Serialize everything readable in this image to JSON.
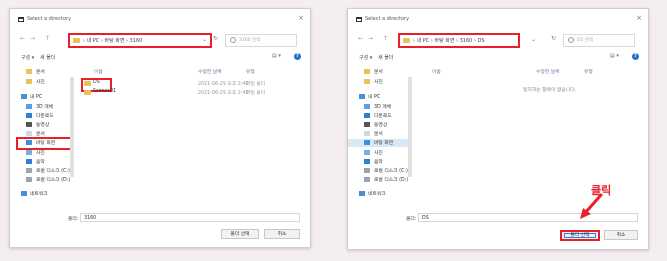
{
  "left_dialog": {
    "title": "Select a directory",
    "close": "×",
    "nav": {
      "back": "←",
      "forward": "→",
      "up": "↑"
    },
    "address": {
      "path": "› 내 PC › 바탕 화면 › 3160",
      "dropdown": "⌄"
    },
    "refresh": "↻",
    "search": {
      "placeholder": "3160 검색"
    },
    "commands": {
      "organize": "구성 ▾",
      "new_folder": "새 폴더",
      "view": "▤ ▾",
      "help": "?"
    },
    "sidebar": [
      {
        "label": "문서",
        "icon": "folder-icon"
      },
      {
        "label": "사진",
        "icon": "folder-icon"
      },
      {
        "label": "내 PC",
        "icon": "pc-icon"
      },
      {
        "label": "3D 개체",
        "icon": "cube-icon"
      },
      {
        "label": "다운로드",
        "icon": "download-icon"
      },
      {
        "label": "동영상",
        "icon": "video-icon"
      },
      {
        "label": "문서",
        "icon": "document-icon"
      },
      {
        "label": "바탕 화면",
        "icon": "desktop-icon"
      },
      {
        "label": "사진",
        "icon": "picture-icon"
      },
      {
        "label": "음악",
        "icon": "music-icon"
      },
      {
        "label": "로컬 디스크 (C:)",
        "icon": "drive-icon"
      },
      {
        "label": "로컬 디스크 (D:)",
        "icon": "drive-icon"
      },
      {
        "label": "네트워크",
        "icon": "network-icon"
      }
    ],
    "columns": {
      "name": "이름",
      "date": "수정한 날짜",
      "type": "유형"
    },
    "rows": [
      {
        "name": "DS",
        "date": "2021-06-29 오후 2:40",
        "type": "파일 폴더"
      },
      {
        "name": "Scenes01",
        "date": "2021-06-29 오후 2:40",
        "type": "파일 폴더"
      }
    ],
    "footer": {
      "folder_label": "폴더:",
      "folder_value": "3160",
      "select_button": "폴더 선택",
      "cancel_button": "취소"
    }
  },
  "right_dialog": {
    "title": "Select a directory",
    "close": "×",
    "nav": {
      "back": "←",
      "forward": "→",
      "up": "↑"
    },
    "address": {
      "path": "› 내 PC › 바탕 화면 › 3160 › DS",
      "dropdown": "⌄"
    },
    "refresh": "↻",
    "search": {
      "placeholder": "DS 검색"
    },
    "commands": {
      "organize": "구성 ▾",
      "new_folder": "새 폴더",
      "view": "▤ ▾",
      "help": "?"
    },
    "sidebar": [
      {
        "label": "문서",
        "icon": "folder-icon"
      },
      {
        "label": "사진",
        "icon": "folder-icon"
      },
      {
        "label": "내 PC",
        "icon": "pc-icon"
      },
      {
        "label": "3D 개체",
        "icon": "cube-icon"
      },
      {
        "label": "다운로드",
        "icon": "download-icon"
      },
      {
        "label": "동영상",
        "icon": "video-icon"
      },
      {
        "label": "문서",
        "icon": "document-icon"
      },
      {
        "label": "바탕 화면",
        "icon": "desktop-icon"
      },
      {
        "label": "사진",
        "icon": "picture-icon"
      },
      {
        "label": "음악",
        "icon": "music-icon"
      },
      {
        "label": "로컬 디스크 (C:)",
        "icon": "drive-icon"
      },
      {
        "label": "로컬 디스크 (D:)",
        "icon": "drive-icon"
      },
      {
        "label": "네트워크",
        "icon": "network-icon"
      }
    ],
    "columns": {
      "name": "이름",
      "date": "수정한 날짜",
      "type": "유형"
    },
    "empty_message": "일치하는 항목이 없습니다.",
    "footer": {
      "folder_label": "폴더:",
      "folder_value": "DS",
      "select_button": "폴더 선택",
      "cancel_button": "취소"
    }
  },
  "annotation": {
    "text": "클릭",
    "color": "#e8202a"
  },
  "colors": {
    "highlight": "#e8202a",
    "folder": "#e8c35c",
    "accent": "#1f6fcf"
  }
}
